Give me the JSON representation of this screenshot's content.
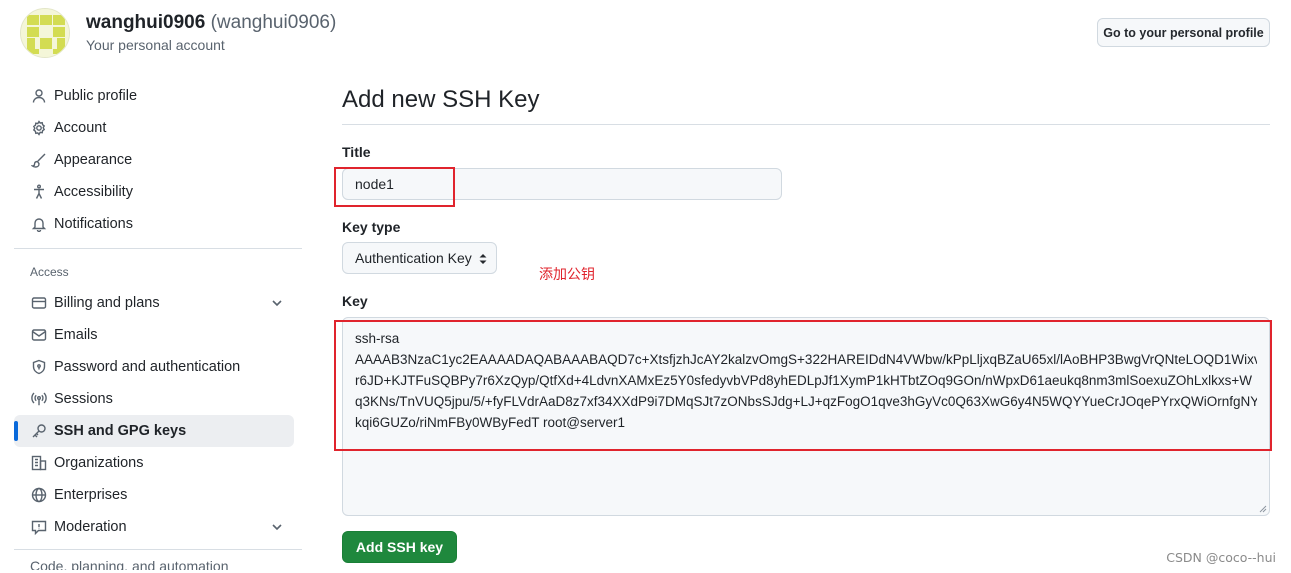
{
  "header": {
    "display_name": "wanghui0906",
    "login": "(wanghui0906)",
    "subtitle": "Your personal account",
    "profile_button": "Go to your personal profile"
  },
  "sidebar": {
    "items": [
      {
        "label": "Public profile",
        "icon": "person-icon"
      },
      {
        "label": "Account",
        "icon": "gear-icon"
      },
      {
        "label": "Appearance",
        "icon": "paintbrush-icon"
      },
      {
        "label": "Accessibility",
        "icon": "accessibility-icon"
      },
      {
        "label": "Notifications",
        "icon": "bell-icon"
      }
    ],
    "access_heading": "Access",
    "access_items": [
      {
        "label": "Billing and plans",
        "icon": "credit-card-icon",
        "expandable": true
      },
      {
        "label": "Emails",
        "icon": "mail-icon"
      },
      {
        "label": "Password and authentication",
        "icon": "shield-lock-icon"
      },
      {
        "label": "Sessions",
        "icon": "broadcast-icon"
      },
      {
        "label": "SSH and GPG keys",
        "icon": "key-icon",
        "active": true
      },
      {
        "label": "Organizations",
        "icon": "organization-icon"
      },
      {
        "label": "Enterprises",
        "icon": "globe-icon"
      },
      {
        "label": "Moderation",
        "icon": "report-icon",
        "expandable": true
      }
    ],
    "cut_off_text": "Code, planning, and automation"
  },
  "form": {
    "page_title": "Add new SSH Key",
    "title_label": "Title",
    "title_value": "node1",
    "key_type_label": "Key type",
    "key_type_value": "Authentication Key",
    "key_label": "Key",
    "key_lines": [
      "ssh-rsa",
      "AAAAB3NzaC1yc2EAAAADAQABAAABAQD7c+XtsfjzhJcAY2kalzvOmgS+322HAREIDdN4VWbw/kPpLljxqBZaU65xl/lAoBHP3BwgVrQNteLOQD1Wixv",
      "r6JD+KJTFuSQBPy7r6XzQyp/QtfXd+4LdvnXAMxEz5Y0sfedyvbVPd8yhEDLpJf1XymP1kHTbtZOq9GOn/nWpxD61aeukq8nm3mlSoexuZOhLxlkxs+W",
      "q3KNs/TnVUQ5jpu/5/+fyFLVdrAaD8z7xf34XXdP9i7DMqSJt7zONbsSJdg+LJ+qzFogO1qve3hGyVc0Q63XwG6y4N5WQYYueCrJOqePYrxQWiOrnfgNY",
      "kqi6GUZo/riNmFBy0WByFedT root@server1"
    ],
    "submit_label": "Add SSH key"
  },
  "annotation": {
    "text": "添加公钥",
    "color": "#e0242d"
  },
  "watermark": "CSDN @coco--hui",
  "colors": {
    "accent": "#0969da",
    "primary_button": "#1f883d",
    "annotation_red": "#e0242d"
  }
}
